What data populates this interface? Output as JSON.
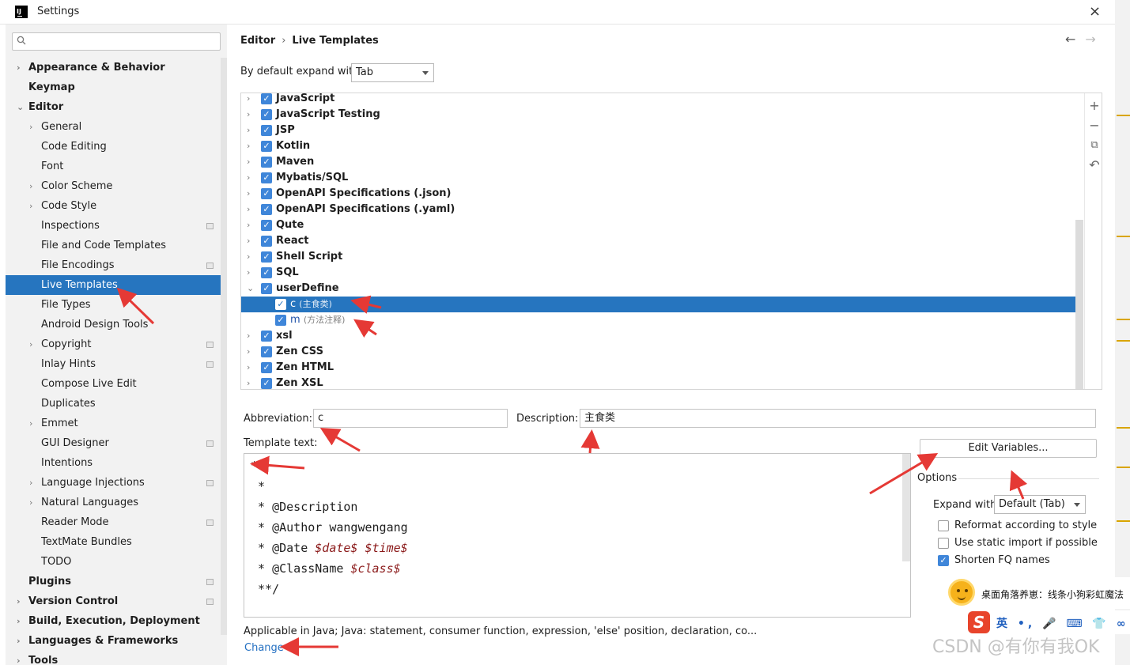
{
  "window": {
    "title": "Settings",
    "app_icon": "intellij-icon",
    "close": "×"
  },
  "sidebar": {
    "search_placeholder": "",
    "items": [
      {
        "label": "Appearance & Behavior",
        "bold": true,
        "chevron": "›",
        "indent": 1
      },
      {
        "label": "Keymap",
        "bold": true,
        "indent": 1
      },
      {
        "label": "Editor",
        "bold": true,
        "chevron": "⌄",
        "indent": 1
      },
      {
        "label": "General",
        "chevron": "›",
        "indent": 2
      },
      {
        "label": "Code Editing",
        "indent": 2
      },
      {
        "label": "Font",
        "indent": 2
      },
      {
        "label": "Color Scheme",
        "chevron": "›",
        "indent": 2
      },
      {
        "label": "Code Style",
        "chevron": "›",
        "indent": 2
      },
      {
        "label": "Inspections",
        "indent": 2,
        "project": true
      },
      {
        "label": "File and Code Templates",
        "indent": 2
      },
      {
        "label": "File Encodings",
        "indent": 2,
        "project": true
      },
      {
        "label": "Live Templates",
        "indent": 2,
        "selected": true
      },
      {
        "label": "File Types",
        "indent": 2
      },
      {
        "label": "Android Design Tools",
        "indent": 2
      },
      {
        "label": "Copyright",
        "chevron": "›",
        "indent": 2,
        "project": true
      },
      {
        "label": "Inlay Hints",
        "indent": 2,
        "project": true
      },
      {
        "label": "Compose Live Edit",
        "indent": 2
      },
      {
        "label": "Duplicates",
        "indent": 2
      },
      {
        "label": "Emmet",
        "chevron": "›",
        "indent": 2
      },
      {
        "label": "GUI Designer",
        "indent": 2,
        "project": true
      },
      {
        "label": "Intentions",
        "indent": 2
      },
      {
        "label": "Language Injections",
        "chevron": "›",
        "indent": 2,
        "project": true
      },
      {
        "label": "Natural Languages",
        "chevron": "›",
        "indent": 2
      },
      {
        "label": "Reader Mode",
        "indent": 2,
        "project": true
      },
      {
        "label": "TextMate Bundles",
        "indent": 2
      },
      {
        "label": "TODO",
        "indent": 2
      },
      {
        "label": "Plugins",
        "bold": true,
        "indent": 1,
        "project": true
      },
      {
        "label": "Version Control",
        "bold": true,
        "chevron": "›",
        "indent": 1,
        "project": true
      },
      {
        "label": "Build, Execution, Deployment",
        "bold": true,
        "chevron": "›",
        "indent": 1
      },
      {
        "label": "Languages & Frameworks",
        "bold": true,
        "chevron": "›",
        "indent": 1
      },
      {
        "label": "Tools",
        "bold": true,
        "chevron": "›",
        "indent": 1
      }
    ]
  },
  "breadcrumb": {
    "parent": "Editor",
    "separator": "›",
    "current": "Live Templates"
  },
  "nav": {
    "back": "←",
    "forward": "→"
  },
  "expand": {
    "label": "By default expand with",
    "value": "Tab"
  },
  "tree": {
    "groups": [
      {
        "label": "JavaScript",
        "chevron": "›"
      },
      {
        "label": "JavaScript Testing",
        "chevron": "›"
      },
      {
        "label": "JSP",
        "chevron": "›"
      },
      {
        "label": "Kotlin",
        "chevron": "›"
      },
      {
        "label": "Maven",
        "chevron": "›"
      },
      {
        "label": "Mybatis/SQL",
        "chevron": "›"
      },
      {
        "label": "OpenAPI Specifications (.json)",
        "chevron": "›"
      },
      {
        "label": "OpenAPI Specifications (.yaml)",
        "chevron": "›"
      },
      {
        "label": "Qute",
        "chevron": "›"
      },
      {
        "label": "React",
        "chevron": "›"
      },
      {
        "label": "Shell Script",
        "chevron": "›"
      },
      {
        "label": "SQL",
        "chevron": "›"
      },
      {
        "label": "userDefine",
        "chevron": "⌄"
      },
      {
        "label": "c",
        "desc": "(主食类)",
        "child": true,
        "selected": true
      },
      {
        "label": "m",
        "desc": "(方法注释)",
        "child": true
      },
      {
        "label": "xsl",
        "chevron": "›"
      },
      {
        "label": "Zen CSS",
        "chevron": "›"
      },
      {
        "label": "Zen HTML",
        "chevron": "›"
      },
      {
        "label": "Zen XSL",
        "chevron": "›"
      }
    ],
    "tools": {
      "add": "+",
      "remove": "−",
      "copy": "⧉",
      "restore": "↶"
    }
  },
  "abbreviation": {
    "label": "Abbreviation:",
    "value": "c"
  },
  "description": {
    "label": "Description:",
    "value": "主食类"
  },
  "template_text": {
    "label": "Template text:",
    "lines": [
      {
        "text": "*"
      },
      {
        "text": " *"
      },
      {
        "text": " * @Description"
      },
      {
        "text": " * @Author wangwengang"
      },
      {
        "text": " * @Date ",
        "vars": "$date$ $time$"
      },
      {
        "text": " * @ClassName ",
        "vars": "$class$"
      },
      {
        "text": " **/"
      }
    ]
  },
  "edit_variables": "Edit Variables...",
  "options": {
    "title": "Options",
    "expand_label": "Expand with",
    "expand_value": "Default (Tab)",
    "reformat": {
      "label": "Reformat according to style",
      "checked": false
    },
    "static_import": {
      "label": "Use static import if possible",
      "checked": false
    },
    "shorten_fq": {
      "label": "Shorten FQ names",
      "checked": true
    }
  },
  "applicable": "Applicable in Java; Java: statement, consumer function, expression, 'else' position, declaration, co...",
  "change_link": "Change",
  "notification": {
    "text": "桌面角落养崽：线条小狗彩虹魔法"
  },
  "ime": {
    "logo": "S",
    "text": "英 •, 🎤 ⌨ 👕 ∞ ⊞"
  },
  "watermark": "CSDN @有你有我OK",
  "colors": {
    "selection": "#2675bf",
    "checkbox": "#3f86d9",
    "annotation_arrow": "#e53935",
    "template_var": "#8b1a1a",
    "link": "#2470c2"
  }
}
